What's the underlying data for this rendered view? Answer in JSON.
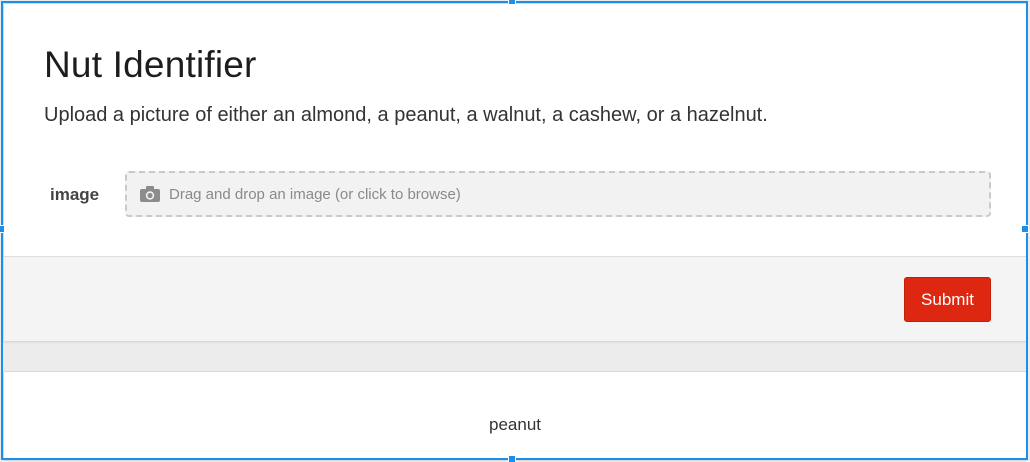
{
  "app": {
    "title": "Nut Identifier",
    "description": "Upload a picture of either an almond, a peanut, a walnut, a cashew, or a hazelnut."
  },
  "form": {
    "image_label": "image",
    "dropzone_text": "Drag and drop an image (or click to browse)",
    "dropzone_icon": "camera-icon",
    "submit_label": "Submit"
  },
  "result": {
    "label": "peanut"
  },
  "colors": {
    "submit_bg": "#dd2710",
    "selection_frame": "#1e8fe8",
    "page_bg": "#ececec"
  }
}
